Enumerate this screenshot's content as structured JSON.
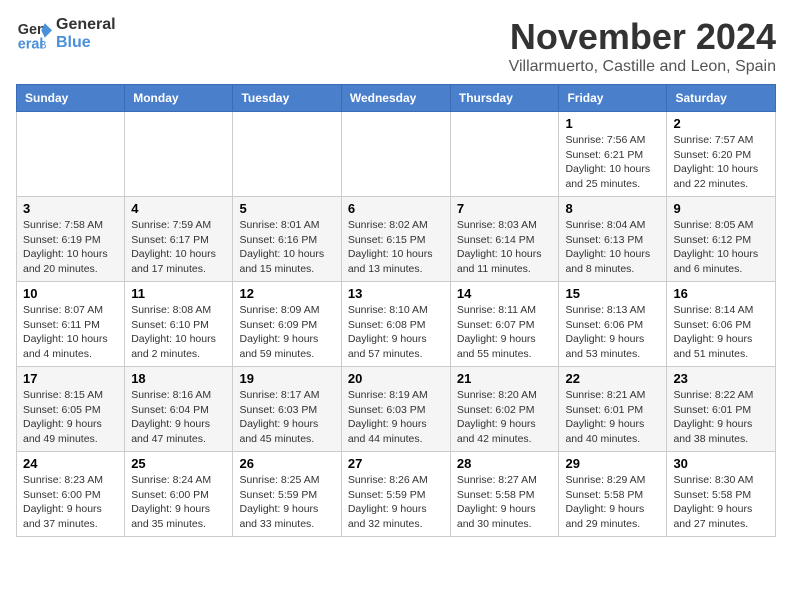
{
  "logo": {
    "line1": "General",
    "line2": "Blue"
  },
  "title": "November 2024",
  "subtitle": "Villarmuerto, Castille and Leon, Spain",
  "weekdays": [
    "Sunday",
    "Monday",
    "Tuesday",
    "Wednesday",
    "Thursday",
    "Friday",
    "Saturday"
  ],
  "weeks": [
    [
      {
        "day": "",
        "info": ""
      },
      {
        "day": "",
        "info": ""
      },
      {
        "day": "",
        "info": ""
      },
      {
        "day": "",
        "info": ""
      },
      {
        "day": "",
        "info": ""
      },
      {
        "day": "1",
        "info": "Sunrise: 7:56 AM\nSunset: 6:21 PM\nDaylight: 10 hours and 25 minutes."
      },
      {
        "day": "2",
        "info": "Sunrise: 7:57 AM\nSunset: 6:20 PM\nDaylight: 10 hours and 22 minutes."
      }
    ],
    [
      {
        "day": "3",
        "info": "Sunrise: 7:58 AM\nSunset: 6:19 PM\nDaylight: 10 hours and 20 minutes."
      },
      {
        "day": "4",
        "info": "Sunrise: 7:59 AM\nSunset: 6:17 PM\nDaylight: 10 hours and 17 minutes."
      },
      {
        "day": "5",
        "info": "Sunrise: 8:01 AM\nSunset: 6:16 PM\nDaylight: 10 hours and 15 minutes."
      },
      {
        "day": "6",
        "info": "Sunrise: 8:02 AM\nSunset: 6:15 PM\nDaylight: 10 hours and 13 minutes."
      },
      {
        "day": "7",
        "info": "Sunrise: 8:03 AM\nSunset: 6:14 PM\nDaylight: 10 hours and 11 minutes."
      },
      {
        "day": "8",
        "info": "Sunrise: 8:04 AM\nSunset: 6:13 PM\nDaylight: 10 hours and 8 minutes."
      },
      {
        "day": "9",
        "info": "Sunrise: 8:05 AM\nSunset: 6:12 PM\nDaylight: 10 hours and 6 minutes."
      }
    ],
    [
      {
        "day": "10",
        "info": "Sunrise: 8:07 AM\nSunset: 6:11 PM\nDaylight: 10 hours and 4 minutes."
      },
      {
        "day": "11",
        "info": "Sunrise: 8:08 AM\nSunset: 6:10 PM\nDaylight: 10 hours and 2 minutes."
      },
      {
        "day": "12",
        "info": "Sunrise: 8:09 AM\nSunset: 6:09 PM\nDaylight: 9 hours and 59 minutes."
      },
      {
        "day": "13",
        "info": "Sunrise: 8:10 AM\nSunset: 6:08 PM\nDaylight: 9 hours and 57 minutes."
      },
      {
        "day": "14",
        "info": "Sunrise: 8:11 AM\nSunset: 6:07 PM\nDaylight: 9 hours and 55 minutes."
      },
      {
        "day": "15",
        "info": "Sunrise: 8:13 AM\nSunset: 6:06 PM\nDaylight: 9 hours and 53 minutes."
      },
      {
        "day": "16",
        "info": "Sunrise: 8:14 AM\nSunset: 6:06 PM\nDaylight: 9 hours and 51 minutes."
      }
    ],
    [
      {
        "day": "17",
        "info": "Sunrise: 8:15 AM\nSunset: 6:05 PM\nDaylight: 9 hours and 49 minutes."
      },
      {
        "day": "18",
        "info": "Sunrise: 8:16 AM\nSunset: 6:04 PM\nDaylight: 9 hours and 47 minutes."
      },
      {
        "day": "19",
        "info": "Sunrise: 8:17 AM\nSunset: 6:03 PM\nDaylight: 9 hours and 45 minutes."
      },
      {
        "day": "20",
        "info": "Sunrise: 8:19 AM\nSunset: 6:03 PM\nDaylight: 9 hours and 44 minutes."
      },
      {
        "day": "21",
        "info": "Sunrise: 8:20 AM\nSunset: 6:02 PM\nDaylight: 9 hours and 42 minutes."
      },
      {
        "day": "22",
        "info": "Sunrise: 8:21 AM\nSunset: 6:01 PM\nDaylight: 9 hours and 40 minutes."
      },
      {
        "day": "23",
        "info": "Sunrise: 8:22 AM\nSunset: 6:01 PM\nDaylight: 9 hours and 38 minutes."
      }
    ],
    [
      {
        "day": "24",
        "info": "Sunrise: 8:23 AM\nSunset: 6:00 PM\nDaylight: 9 hours and 37 minutes."
      },
      {
        "day": "25",
        "info": "Sunrise: 8:24 AM\nSunset: 6:00 PM\nDaylight: 9 hours and 35 minutes."
      },
      {
        "day": "26",
        "info": "Sunrise: 8:25 AM\nSunset: 5:59 PM\nDaylight: 9 hours and 33 minutes."
      },
      {
        "day": "27",
        "info": "Sunrise: 8:26 AM\nSunset: 5:59 PM\nDaylight: 9 hours and 32 minutes."
      },
      {
        "day": "28",
        "info": "Sunrise: 8:27 AM\nSunset: 5:58 PM\nDaylight: 9 hours and 30 minutes."
      },
      {
        "day": "29",
        "info": "Sunrise: 8:29 AM\nSunset: 5:58 PM\nDaylight: 9 hours and 29 minutes."
      },
      {
        "day": "30",
        "info": "Sunrise: 8:30 AM\nSunset: 5:58 PM\nDaylight: 9 hours and 27 minutes."
      }
    ]
  ]
}
